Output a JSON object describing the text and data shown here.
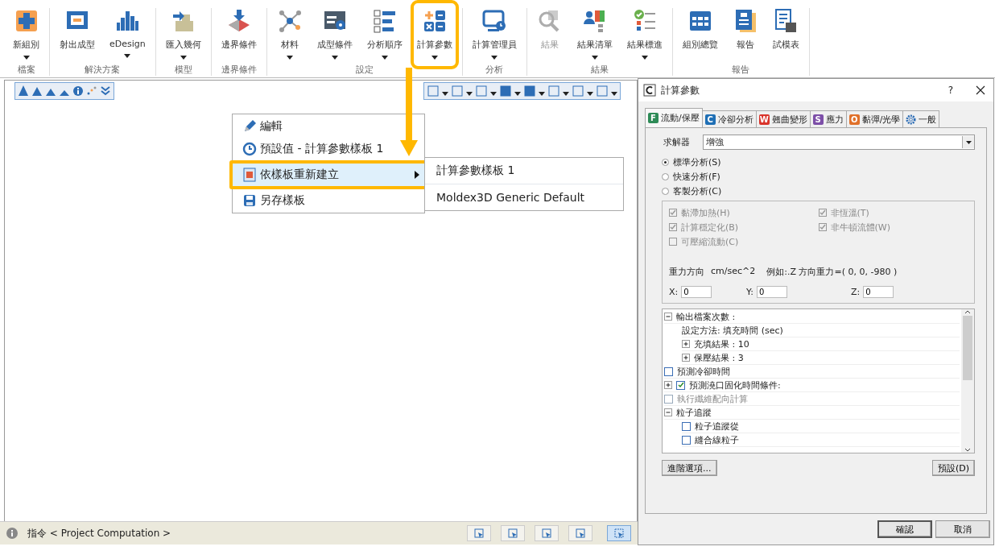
{
  "ribbon": {
    "groups": [
      {
        "label": "檔案",
        "buttons": [
          {
            "label": "新組別",
            "dropdown": true,
            "disabled": false,
            "highlighted": false
          }
        ]
      },
      {
        "label": "解決方案",
        "buttons": [
          {
            "label": "射出成型",
            "dropdown": false,
            "disabled": false,
            "highlighted": false
          },
          {
            "label": "eDesign",
            "dropdown": true,
            "disabled": false,
            "highlighted": false
          }
        ]
      },
      {
        "label": "模型",
        "buttons": [
          {
            "label": "匯入幾何",
            "dropdown": true,
            "disabled": false,
            "highlighted": false
          }
        ]
      },
      {
        "label": "邊界條件",
        "buttons": [
          {
            "label": "邊界條件",
            "dropdown": false,
            "disabled": false,
            "highlighted": false
          }
        ]
      },
      {
        "label": "設定",
        "buttons": [
          {
            "label": "材料",
            "dropdown": true,
            "disabled": false,
            "highlighted": false
          },
          {
            "label": "成型條件",
            "dropdown": true,
            "disabled": false,
            "highlighted": false
          },
          {
            "label": "分析順序",
            "dropdown": true,
            "disabled": false,
            "highlighted": false
          },
          {
            "label": "計算參數",
            "dropdown": true,
            "disabled": false,
            "highlighted": true
          }
        ]
      },
      {
        "label": "分析",
        "buttons": [
          {
            "label": "計算管理員",
            "dropdown": true,
            "disabled": false,
            "highlighted": false
          }
        ]
      },
      {
        "label": "結果",
        "buttons": [
          {
            "label": "結果",
            "dropdown": false,
            "disabled": true,
            "highlighted": false
          },
          {
            "label": "結果清單",
            "dropdown": true,
            "disabled": false,
            "highlighted": false
          },
          {
            "label": "結果標進",
            "dropdown": true,
            "disabled": false,
            "highlighted": false
          }
        ]
      },
      {
        "label": "報告",
        "buttons": [
          {
            "label": "組別總覽",
            "dropdown": false,
            "disabled": false,
            "highlighted": false
          },
          {
            "label": "報告",
            "dropdown": false,
            "disabled": false,
            "highlighted": false
          },
          {
            "label": "試模表",
            "dropdown": false,
            "disabled": false,
            "highlighted": false
          }
        ]
      }
    ]
  },
  "context_menu": {
    "items": [
      {
        "label": "編輯",
        "submenu": false,
        "selected": false,
        "highlighted": false
      },
      {
        "label": "預設值 - 計算參數樣板 1",
        "submenu": false,
        "selected": false,
        "highlighted": false
      },
      {
        "label": "依樣板重新建立",
        "submenu": true,
        "selected": true,
        "highlighted": true
      },
      {
        "label": "另存樣板",
        "submenu": false,
        "selected": false,
        "highlighted": false
      }
    ],
    "submenu": [
      "計算參數樣板 1",
      "Moldex3D Generic Default"
    ]
  },
  "status_bar": {
    "text": "指令 < Project Computation >",
    "tools": [
      {
        "selected": false
      },
      {
        "selected": false
      },
      {
        "selected": false
      },
      {
        "selected": false
      },
      {
        "selected": true
      }
    ]
  },
  "dialog": {
    "title": "計算參數",
    "help": "?",
    "tabs": [
      {
        "badge": "F",
        "color": "#2e8b57",
        "label": "流動/保壓",
        "selected": true
      },
      {
        "badge": "C",
        "color": "#1f6fb5",
        "label": "冷卻分析",
        "selected": false
      },
      {
        "badge": "W",
        "color": "#d9342b",
        "label": "翹曲變形",
        "selected": false
      },
      {
        "badge": "S",
        "color": "#7d4fa8",
        "label": "應力",
        "selected": false
      },
      {
        "badge": "O",
        "color": "#e0702a",
        "label": "黏彈/光學",
        "selected": false
      },
      {
        "label": "一般",
        "selected": false
      }
    ],
    "solver": {
      "label": "求解器",
      "value": "增強"
    },
    "analysis": [
      {
        "label": "標準分析(S)",
        "selected": true
      },
      {
        "label": "快速分析(F)",
        "selected": false
      },
      {
        "label": "客製分析(C)",
        "selected": false
      }
    ],
    "options": [
      {
        "label": "黏滯加熱(H)",
        "checked": true,
        "disabled": true
      },
      {
        "label": "非恆溫(T)",
        "checked": true,
        "disabled": true
      },
      {
        "label": "計算穩定化(B)",
        "checked": true,
        "disabled": true
      },
      {
        "label": "非牛頓流體(W)",
        "checked": true,
        "disabled": true
      },
      {
        "label": "可壓縮流動(C)",
        "checked": false,
        "disabled": true
      }
    ],
    "gravity": {
      "label": "重力方向",
      "unit": "cm/sec^2",
      "example": "例如:.Z 方向重力=( 0, 0, -980 )",
      "fields": [
        {
          "label": "X:",
          "value": "0"
        },
        {
          "label": "Y:",
          "value": "0"
        },
        {
          "label": "Z:",
          "value": "0"
        }
      ]
    },
    "tree": [
      {
        "label": "輸出檔案次數 :",
        "expanded": true,
        "disabled": false,
        "children": [
          {
            "label": "設定方法: 填充時間 (sec)",
            "disabled": false
          },
          {
            "label": "充填結果 : 10",
            "expanded": false,
            "disabled": false
          },
          {
            "label": "保壓結果 : 3",
            "expanded": false,
            "disabled": false
          }
        ]
      },
      {
        "label": "預測冷卻時間",
        "checked": false,
        "disabled": false
      },
      {
        "label": "預測澆口固化時間條件:",
        "expanded": false,
        "checked": true,
        "disabled": false
      },
      {
        "label": "執行纖維配向計算",
        "checked": false,
        "disabled": true
      },
      {
        "label": "粒子追蹤",
        "expanded": true,
        "disabled": false,
        "children": [
          {
            "label": "粒子追蹤從",
            "checked": false,
            "disabled": false
          },
          {
            "label": "縫合線粒子",
            "checked": false,
            "disabled": false
          }
        ]
      }
    ],
    "advanced_button": "進階選項...",
    "default_button": "預設(D)",
    "ok_button": "確認",
    "cancel_button": "取消"
  }
}
